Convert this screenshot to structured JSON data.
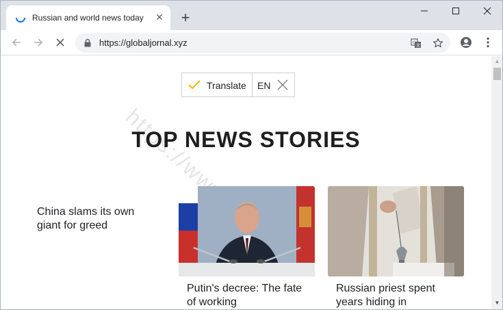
{
  "tab": {
    "title": "Russian and world news today",
    "close": "✕",
    "new_tab": "+"
  },
  "window": {
    "minimize": "—",
    "maximize": "☐",
    "close": "✕"
  },
  "toolbar": {
    "url": "https://globaljornal.xyz"
  },
  "translate": {
    "label": "Translate",
    "language": "EN"
  },
  "page": {
    "headline": "TOP NEWS STORIES",
    "watermark": "https://www.great",
    "story_text": "China slams its own giant for greed",
    "cards": [
      {
        "caption": "Putin's decree: The fate of working"
      },
      {
        "caption": "Russian priest spent years hiding in"
      }
    ]
  },
  "colors": {
    "accent": "#1a73e8",
    "check": "#f2b705",
    "tabstrip": "#dee1e6",
    "omnibox": "#f1f3f4"
  }
}
